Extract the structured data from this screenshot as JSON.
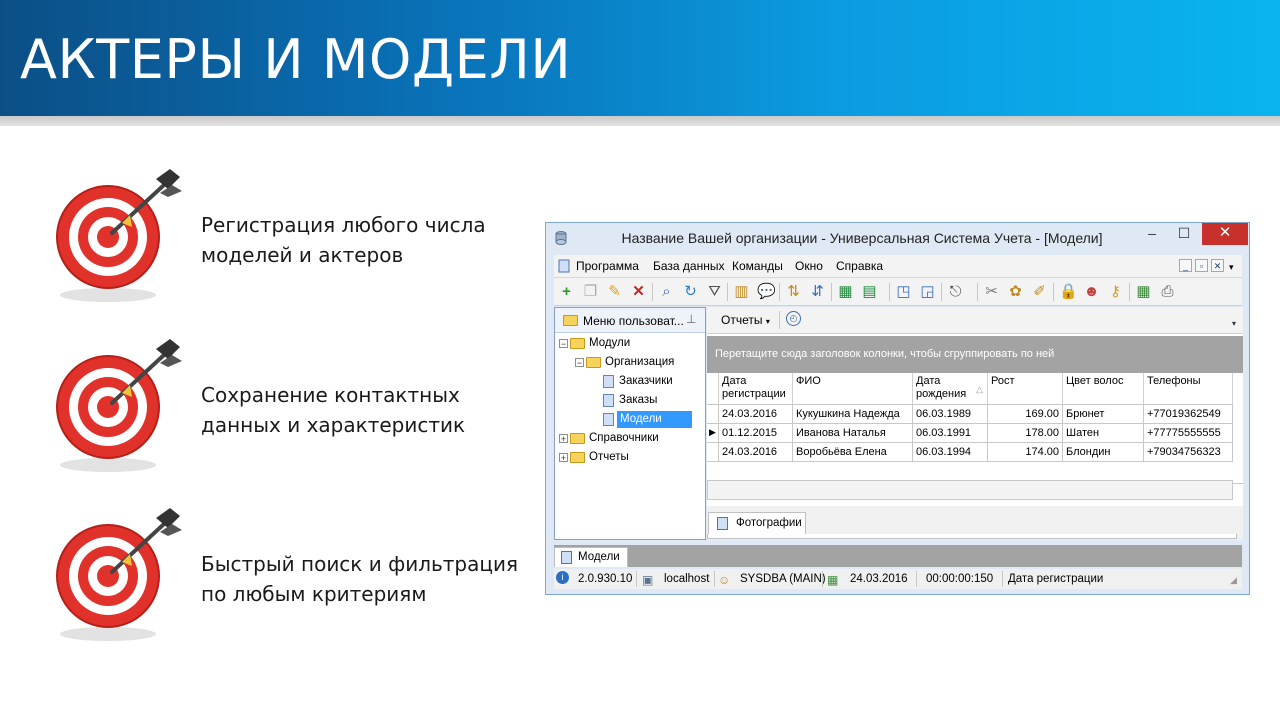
{
  "slide": {
    "title": "АКТЕРЫ И МОДЕЛИ",
    "bullets": [
      {
        "line1": "Регистрация любого числа",
        "line2": "моделей и актеров"
      },
      {
        "line1": "Сохранение контактных",
        "line2": "данных и характеристик"
      },
      {
        "line1": "Быстрый поиск и фильтрация",
        "line2": "по любым критериям"
      }
    ]
  },
  "window": {
    "title": "Название Вашей организации - Универсальная Система Учета - [Модели]",
    "controls": {
      "minimize": "–",
      "maximize": "☐",
      "close": "✕"
    },
    "menu": [
      "Программа",
      "База данных",
      "Команды",
      "Окно",
      "Справка"
    ],
    "left_panel": {
      "header": "Меню пользоват...",
      "tree": {
        "modules": "Модули",
        "organization": "Организация",
        "customers": "Заказчики",
        "orders": "Заказы",
        "models": "Модели",
        "references": "Справочники",
        "reports": "Отчеты"
      }
    },
    "right_panel": {
      "reports_button": "Отчеты",
      "group_hint": "Перетащите сюда заголовок колонки, чтобы сгруппировать по ней",
      "columns": [
        {
          "line1": "Дата",
          "line2": "регистрации"
        },
        {
          "line1": "ФИО",
          "line2": ""
        },
        {
          "line1": "Дата",
          "line2": "рождения"
        },
        {
          "line1": "Рост",
          "line2": ""
        },
        {
          "line1": "Цвет волос",
          "line2": ""
        },
        {
          "line1": "Телефоны",
          "line2": ""
        }
      ],
      "rows": [
        {
          "reg": "24.03.2016",
          "name": "Кукушкина Надежда",
          "birth": "06.03.1989",
          "height": "169.00",
          "hair": "Брюнет",
          "phone": "+77019362549"
        },
        {
          "reg": "01.12.2015",
          "name": "Иванова Наталья",
          "birth": "06.03.1991",
          "height": "178.00",
          "hair": "Шатен",
          "phone": "+77775555555"
        },
        {
          "reg": "24.03.2016",
          "name": "Воробьёва Елена",
          "birth": "06.03.1994",
          "height": "174.00",
          "hair": "Блондин",
          "phone": "+79034756323"
        }
      ],
      "detail_tab": "Фотографии"
    },
    "document_tab": "Модели",
    "status": {
      "version": "2.0.930.10",
      "host": "localhost",
      "user": "SYSDBA (MAIN)",
      "date": "24.03.2016",
      "time": "00:00:00:150",
      "field": "Дата регистрации"
    }
  },
  "colors": {
    "banner_dark": "#0b4f86",
    "banner_light": "#09b4ee",
    "close_button": "#c7302b",
    "selection": "#3399ff"
  }
}
